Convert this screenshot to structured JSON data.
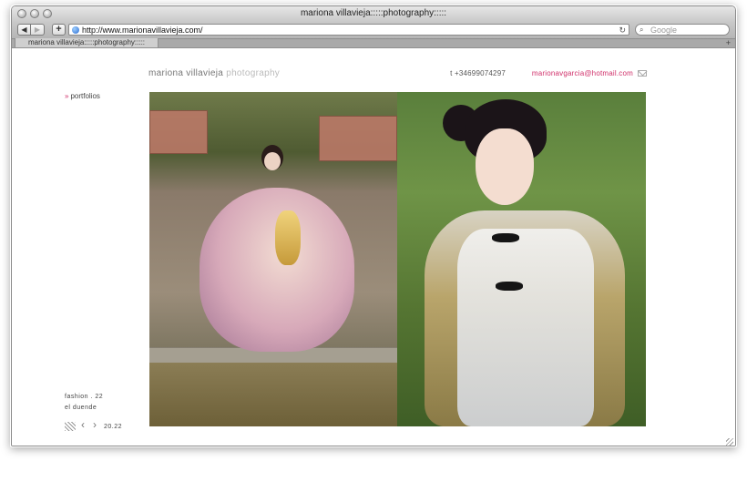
{
  "window": {
    "title": "mariona villavieja:::::photography:::::"
  },
  "toolbar": {
    "back_label": "◀",
    "forward_label": "▶",
    "add_label": "+",
    "url": "http://www.marionavillavieja.com/",
    "reload_label": "↻",
    "search_placeholder": "Google"
  },
  "tabs": [
    {
      "label": "mariona villavieja:::::photography:::::"
    }
  ],
  "site": {
    "logo_name": "mariona villavieja",
    "logo_suffix": "photography",
    "phone": "t +34699074297",
    "email": "marionavgarcia@hotmail.com",
    "nav_arrow": "»",
    "nav_portfolios": "portfolios",
    "caption_category": "fashion . 22",
    "caption_series": "el duende",
    "counter": "20.22"
  },
  "colors": {
    "accent": "#d0306a",
    "logo_gray": "#777777",
    "logo_light": "#bbbbbb"
  },
  "icons": {
    "grid": "grid-icon",
    "prev": "chevron-left-icon",
    "next": "chevron-right-icon",
    "mail": "mail-icon"
  }
}
